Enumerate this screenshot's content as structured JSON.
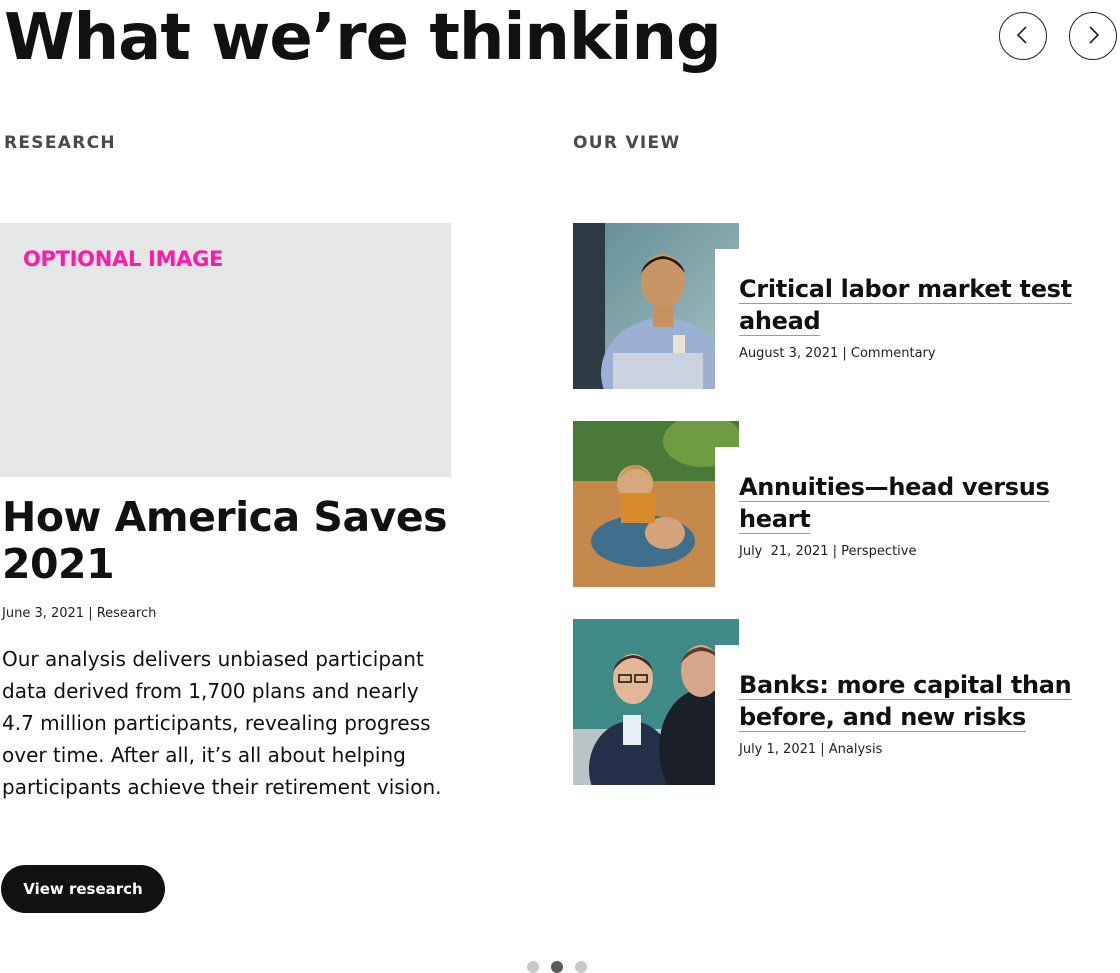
{
  "header": {
    "title": "What we’re thinking",
    "prev_icon": "chevron-left-icon",
    "next_icon": "chevron-right-icon"
  },
  "sections": {
    "research_label": "RESEARCH",
    "ourview_label": "OUR VIEW"
  },
  "feature": {
    "image_label": "OPTIONAL IMAGE",
    "title": "How America Saves 2021",
    "meta": "June 3, 2021 | Research",
    "description": "Our analysis delivers unbiased participant data derived from 1,700 plans and nearly 4.7 million participants, revealing progress over time. After all, it’s all about helping participants achieve their retirement vision.",
    "cta_label": "View research"
  },
  "articles": [
    {
      "title": "Critical labor market test ahead",
      "meta": "August 3, 2021 | Commentary",
      "image_icon": "businessman-photo"
    },
    {
      "title": "Annuities—head versus heart",
      "meta": "July  21, 2021 | Perspective",
      "image_icon": "family-photo"
    },
    {
      "title": "Banks: more capital than before, and new risks",
      "meta": "July 1, 2021 | Analysis",
      "image_icon": "meeting-photo"
    }
  ],
  "pagination": {
    "count": 3,
    "active": 2
  },
  "colors": {
    "accent_pink": "#ff1aa8",
    "text_dark": "#111111",
    "placeholder_gray": "#e5e7e6",
    "dot_active": "#5a5a5a",
    "dot_inactive": "#c9c9c9"
  }
}
